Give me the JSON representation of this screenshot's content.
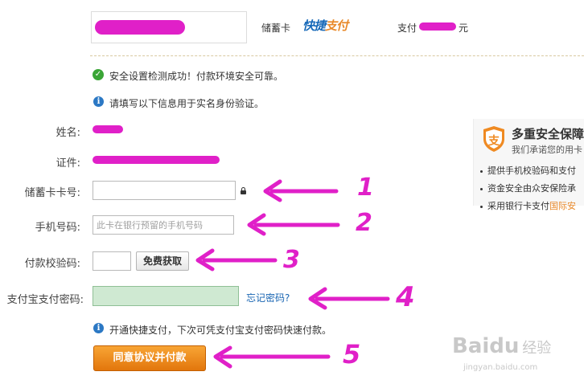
{
  "header": {
    "card_type": "储蓄卡",
    "kuaijie_logo_part1": "快捷",
    "kuaijie_logo_part2": "支付",
    "pay_prefix": "支付",
    "pay_suffix": "元"
  },
  "notices": {
    "security_check": "安全设置检测成功！付款环境安全可靠。",
    "realname": "请填写以下信息用于实名身份验证。",
    "quickpay_tip": "开通快捷支付，下次可凭支付宝支付密码快速付款。"
  },
  "form": {
    "name_label": "姓名:",
    "id_label": "证件:",
    "card_label": "储蓄卡卡号:",
    "card_value": "",
    "phone_label": "手机号码:",
    "phone_placeholder": "此卡在银行预留的手机号码",
    "code_label": "付款校验码:",
    "code_value": "",
    "get_code_button": "免费获取",
    "password_label": "支付宝支付密码:",
    "password_value": "",
    "forgot_password_link": "忘记密码?",
    "pay_button": "同意协议并付款"
  },
  "annotations": {
    "numbers": [
      "1",
      "2",
      "3",
      "4",
      "5"
    ],
    "color": "#e020c8"
  },
  "security_panel": {
    "title": "多重安全保障",
    "subtitle": "我们承诺您的用卡",
    "items": [
      {
        "text": "提供手机校验码和支付"
      },
      {
        "text": "资金安全由众安保险承"
      },
      {
        "text": "采用银行卡支付",
        "highlight": "国际安"
      }
    ]
  },
  "watermark": {
    "brand": "Baidu",
    "cn": "经验",
    "url": "jingyan.baidu.com"
  },
  "colors": {
    "accent_blue": "#1a66b3",
    "pay_orange": "#f08a1f",
    "success_green": "#3aa536",
    "password_field": "#cfe9d2"
  }
}
